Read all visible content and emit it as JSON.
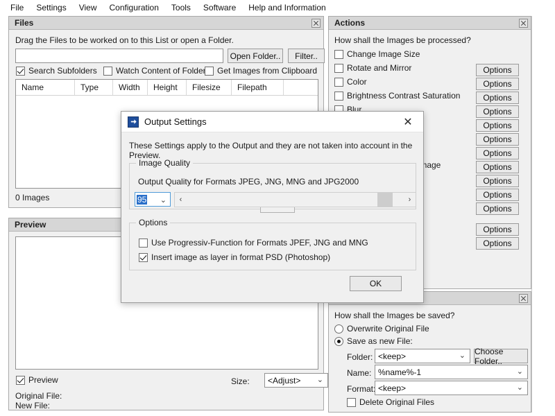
{
  "menubar": {
    "items": [
      {
        "label": "File"
      },
      {
        "label": "Settings"
      },
      {
        "label": "View"
      },
      {
        "label": "Configuration"
      },
      {
        "label": "Tools"
      },
      {
        "label": "Software"
      },
      {
        "label": "Help and Information"
      }
    ]
  },
  "files_panel": {
    "title": "Files",
    "instruction": "Drag the Files to be worked on to this List or open a Folder.",
    "path_value": "",
    "open_folder_label": "Open Folder..",
    "filter_label": "Filter..",
    "checkboxes": [
      {
        "label": "Search Subfolders",
        "checked": true
      },
      {
        "label": "Watch Content of Folder",
        "checked": false
      },
      {
        "label": "Get Images from Clipboard",
        "checked": false
      }
    ],
    "columns": [
      "Name",
      "Type",
      "Width",
      "Height",
      "Filesize",
      "Filepath"
    ],
    "rows": [],
    "status": "0 Images"
  },
  "preview_panel": {
    "title": "Preview",
    "preview_checkbox": {
      "label": "Preview",
      "checked": true
    },
    "size_label": "Size:",
    "size_value": "<Adjust>",
    "original_file_label": "Original File:",
    "new_file_label": "New File:"
  },
  "actions_panel": {
    "title": "Actions",
    "question": "How shall the Images be processed?",
    "options_label": "Options",
    "items": [
      {
        "label": "Change Image Size",
        "checked": false,
        "has_options": true
      },
      {
        "label": "Rotate and Mirror",
        "checked": false,
        "has_options": true
      },
      {
        "label": "Color",
        "checked": false,
        "has_options": true
      },
      {
        "label": "Brightness Contrast Saturation",
        "checked": false,
        "has_options": true
      },
      {
        "label": "Blur",
        "checked": false,
        "has_options": true
      },
      {
        "label": "",
        "checked": false,
        "has_options": true
      },
      {
        "label": "",
        "checked": false,
        "has_options": true
      },
      {
        "label": "Image",
        "checked": false,
        "has_options": true
      },
      {
        "label": "",
        "checked": false,
        "has_options": true
      },
      {
        "label": "",
        "checked": false,
        "has_options": true
      },
      {
        "label": "",
        "checked": false,
        "has_options": true
      }
    ],
    "extra_options_buttons": [
      "Options",
      "Options"
    ]
  },
  "save_panel": {
    "question": "How shall the Images be saved?",
    "overwrite": {
      "label": "Overwrite Original File",
      "selected": false
    },
    "save_as_new": {
      "label": "Save as new File:",
      "selected": true
    },
    "folder_label": "Folder:",
    "folder_value": "<keep>",
    "choose_folder_label": "Choose Folder..",
    "name_label": "Name:",
    "name_value": "%name%-1",
    "format_label": "Format:",
    "format_value": "<keep>",
    "delete_original": {
      "label": "Delete Original Files",
      "checked": false
    }
  },
  "dialog": {
    "title": "Output Settings",
    "icon": "app-blue-icon",
    "close_icon": "close-icon",
    "description": "These Settings apply to the Output and they are not taken into account in the Preview.",
    "image_quality": {
      "legend": "Image Quality",
      "field_label": "Output Quality for Formats JPEG, JNG, MNG and JPG2000",
      "value": "95",
      "slider_left_icon": "chevron-left-icon",
      "slider_right_icon": "chevron-right-icon",
      "thumb_position_pct": 90
    },
    "options": {
      "legend": "Options",
      "items": [
        {
          "label": "Use Progressiv-Function for Formats JPEF, JNG and MNG",
          "checked": false
        },
        {
          "label": "Insert image as layer in format PSD (Photoshop)",
          "checked": true
        }
      ]
    },
    "ok_label": "OK"
  },
  "colors": {
    "panel_bg": "#f0f0f0",
    "title_bg": "#d6d6d6",
    "accent_selection": "#2a6fc9",
    "dialog_icon": "#1f4e9c"
  }
}
